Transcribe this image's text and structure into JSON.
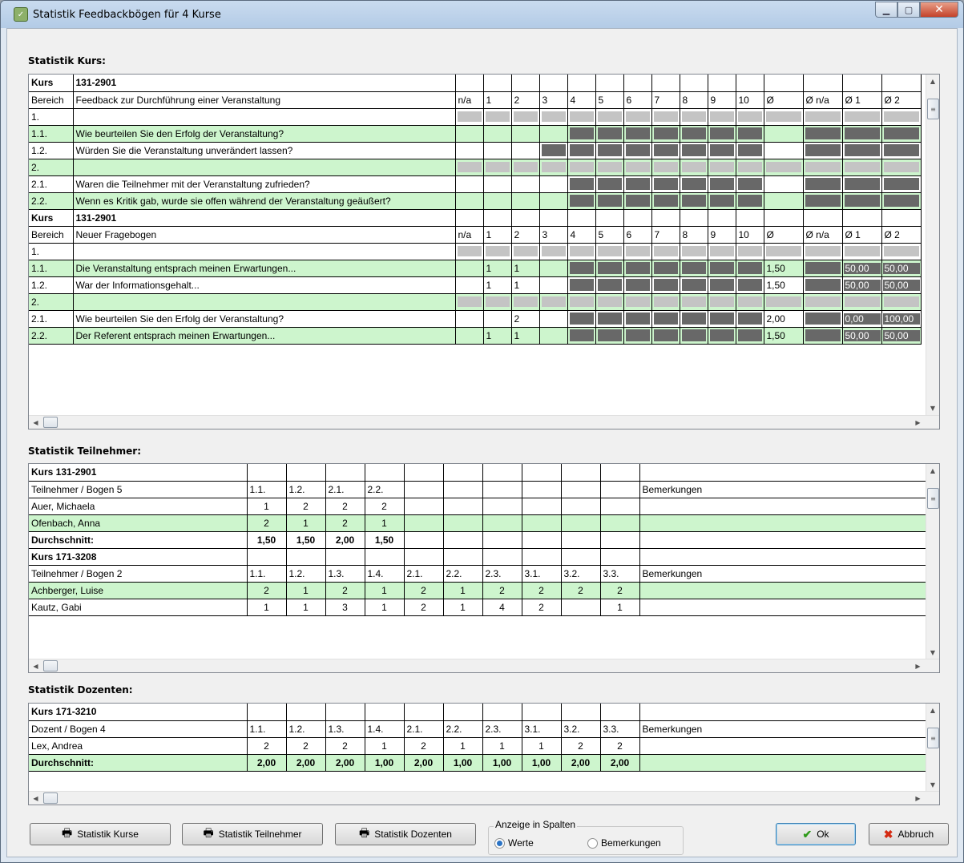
{
  "window": {
    "title": "Statistik Feedbackbögen für 4 Kurse",
    "app_icon": "clipboard-icon"
  },
  "sections": {
    "kurs": "Statistik Kurs:",
    "teilnehmer": "Statistik Teilnehmer:",
    "dozenten": "Statistik Dozenten:"
  },
  "kurs_table": {
    "head": [
      "n/a",
      "1",
      "2",
      "3",
      "4",
      "5",
      "6",
      "7",
      "8",
      "9",
      "10",
      "Ø",
      "Ø n/a",
      "Ø 1",
      "Ø 2"
    ],
    "blocks": [
      {
        "kurs_label": "Kurs",
        "kurs": "131-2901",
        "bereich_label": "Bereich",
        "bereich": "Feedback zur Durchführung einer Veranstaltung",
        "rows": [
          {
            "num": "1.",
            "text": "",
            "style": "wht",
            "cells": [
              "L",
              "L",
              "L",
              "L",
              "L",
              "L",
              "L",
              "L",
              "L",
              "L",
              "L",
              "L",
              "L",
              "L",
              "L"
            ]
          },
          {
            "num": "1.1.",
            "text": "Wie beurteilen Sie den Erfolg der Veranstaltung?",
            "style": "grn",
            "cells": [
              "",
              "",
              "",
              "",
              "D",
              "D",
              "D",
              "D",
              "D",
              "D",
              "D",
              "",
              "D",
              "D",
              "D"
            ]
          },
          {
            "num": "1.2.",
            "text": "Würden Sie die Veranstaltung unverändert lassen?",
            "style": "wht",
            "cells": [
              "",
              "",
              "",
              "D",
              "D",
              "D",
              "D",
              "D",
              "D",
              "D",
              "D",
              "",
              "D",
              "D",
              "D"
            ]
          },
          {
            "num": "2.",
            "text": "",
            "style": "grn",
            "cells": [
              "L",
              "L",
              "L",
              "L",
              "L",
              "L",
              "L",
              "L",
              "L",
              "L",
              "L",
              "L",
              "L",
              "L",
              "L"
            ]
          },
          {
            "num": "2.1.",
            "text": "Waren die Teilnehmer mit der Veranstaltung zufrieden?",
            "style": "wht",
            "cells": [
              "",
              "",
              "",
              "",
              "D",
              "D",
              "D",
              "D",
              "D",
              "D",
              "D",
              "",
              "D",
              "D",
              "D"
            ]
          },
          {
            "num": "2.2.",
            "text": "Wenn es Kritik gab, wurde sie offen während der Veranstaltung geäußert?",
            "style": "grn",
            "cells": [
              "",
              "",
              "",
              "",
              "D",
              "D",
              "D",
              "D",
              "D",
              "D",
              "D",
              "",
              "D",
              "D",
              "D"
            ]
          }
        ]
      },
      {
        "kurs_label": "Kurs",
        "kurs": "131-2901",
        "bereich_label": "Bereich",
        "bereich": "Neuer Fragebogen",
        "rows": [
          {
            "num": "1.",
            "text": "",
            "style": "wht",
            "cells": [
              "L",
              "L",
              "L",
              "L",
              "L",
              "L",
              "L",
              "L",
              "L",
              "L",
              "L",
              "L",
              "L",
              "L",
              "L"
            ]
          },
          {
            "num": "1.1.",
            "text": "Die Veranstaltung entsprach meinen Erwartungen...",
            "style": "grn",
            "cells": [
              "",
              "1",
              "1",
              "",
              "D",
              "D",
              "D",
              "D",
              "D",
              "D",
              "D",
              "1,50",
              "D",
              "#50,00",
              "#50,00"
            ]
          },
          {
            "num": "1.2.",
            "text": "War der Informationsgehalt...",
            "style": "wht",
            "cells": [
              "",
              "1",
              "1",
              "",
              "D",
              "D",
              "D",
              "D",
              "D",
              "D",
              "D",
              "1,50",
              "D",
              "#50,00",
              "#50,00"
            ]
          },
          {
            "num": "2.",
            "text": "",
            "style": "grn",
            "cells": [
              "L",
              "L",
              "L",
              "L",
              "L",
              "L",
              "L",
              "L",
              "L",
              "L",
              "L",
              "L",
              "L",
              "L",
              "L"
            ]
          },
          {
            "num": "2.1.",
            "text": "Wie beurteilen Sie den Erfolg der Veranstaltung?",
            "style": "wht",
            "cells": [
              "",
              "",
              "2",
              "",
              "D",
              "D",
              "D",
              "D",
              "D",
              "D",
              "D",
              "2,00",
              "D",
              "#0,00",
              "#100,00"
            ]
          },
          {
            "num": "2.2.",
            "text": "Der Referent entsprach meinen Erwartungen...",
            "style": "grn",
            "cells": [
              "",
              "1",
              "1",
              "",
              "D",
              "D",
              "D",
              "D",
              "D",
              "D",
              "D",
              "1,50",
              "D",
              "#50,00",
              "#50,00"
            ]
          }
        ]
      }
    ]
  },
  "teilnehmer_table": {
    "blocks": [
      {
        "kurs": "Kurs 131-2901",
        "sub": "Teilnehmer / Bogen 5",
        "cols": [
          "1.1.",
          "1.2.",
          "2.1.",
          "2.2.",
          "",
          "",
          "",
          "",
          "",
          ""
        ],
        "bem": "Bemerkungen",
        "rows": [
          {
            "name": "Auer, Michaela",
            "style": "wht",
            "vals": [
              "1",
              "2",
              "2",
              "2",
              "",
              "",
              "",
              "",
              "",
              ""
            ]
          },
          {
            "name": "Ofenbach, Anna",
            "style": "grn",
            "vals": [
              "2",
              "1",
              "2",
              "1",
              "",
              "",
              "",
              "",
              "",
              ""
            ]
          },
          {
            "name": "Durchschnitt:",
            "style": "wht bold",
            "vals": [
              "1,50",
              "1,50",
              "2,00",
              "1,50",
              "",
              "",
              "",
              "",
              "",
              ""
            ]
          }
        ]
      },
      {
        "kurs": "Kurs 171-3208",
        "sub": "Teilnehmer / Bogen 2",
        "cols": [
          "1.1.",
          "1.2.",
          "1.3.",
          "1.4.",
          "2.1.",
          "2.2.",
          "2.3.",
          "3.1.",
          "3.2.",
          "3.3."
        ],
        "bem": "Bemerkungen",
        "rows": [
          {
            "name": "Achberger, Luise",
            "style": "grn",
            "vals": [
              "2",
              "1",
              "2",
              "1",
              "2",
              "1",
              "2",
              "2",
              "2",
              "2"
            ]
          },
          {
            "name": "Kautz, Gabi",
            "style": "wht",
            "vals": [
              "1",
              "1",
              "3",
              "1",
              "2",
              "1",
              "4",
              "2",
              "",
              "1"
            ]
          }
        ]
      }
    ]
  },
  "dozenten_table": {
    "blocks": [
      {
        "kurs": "Kurs 171-3210",
        "sub": "Dozent / Bogen 4",
        "cols": [
          "1.1.",
          "1.2.",
          "1.3.",
          "1.4.",
          "2.1.",
          "2.2.",
          "2.3.",
          "3.1.",
          "3.2.",
          "3.3."
        ],
        "bem": "Bemerkungen",
        "rows": [
          {
            "name": "Lex, Andrea",
            "style": "wht",
            "vals": [
              "2",
              "2",
              "2",
              "1",
              "2",
              "1",
              "1",
              "1",
              "2",
              "2"
            ]
          },
          {
            "name": "Durchschnitt:",
            "style": "grn bold",
            "vals": [
              "2,00",
              "2,00",
              "2,00",
              "1,00",
              "2,00",
              "1,00",
              "1,00",
              "1,00",
              "2,00",
              "2,00"
            ]
          }
        ]
      }
    ]
  },
  "buttons": {
    "stat_kurse": "Statistik Kurse",
    "stat_teilnehmer": "Statistik Teilnehmer",
    "stat_dozenten": "Statistik Dozenten",
    "ok": "Ok",
    "abbruch": "Abbruch"
  },
  "anzeige": {
    "legend": "Anzeige in Spalten",
    "werte": "Werte",
    "bemerkungen": "Bemerkungen",
    "selected": "Werte"
  },
  "colors": {
    "row_green": "#cdf5cd",
    "cell_light": "#c4c4c4",
    "cell_dark": "#686868"
  }
}
